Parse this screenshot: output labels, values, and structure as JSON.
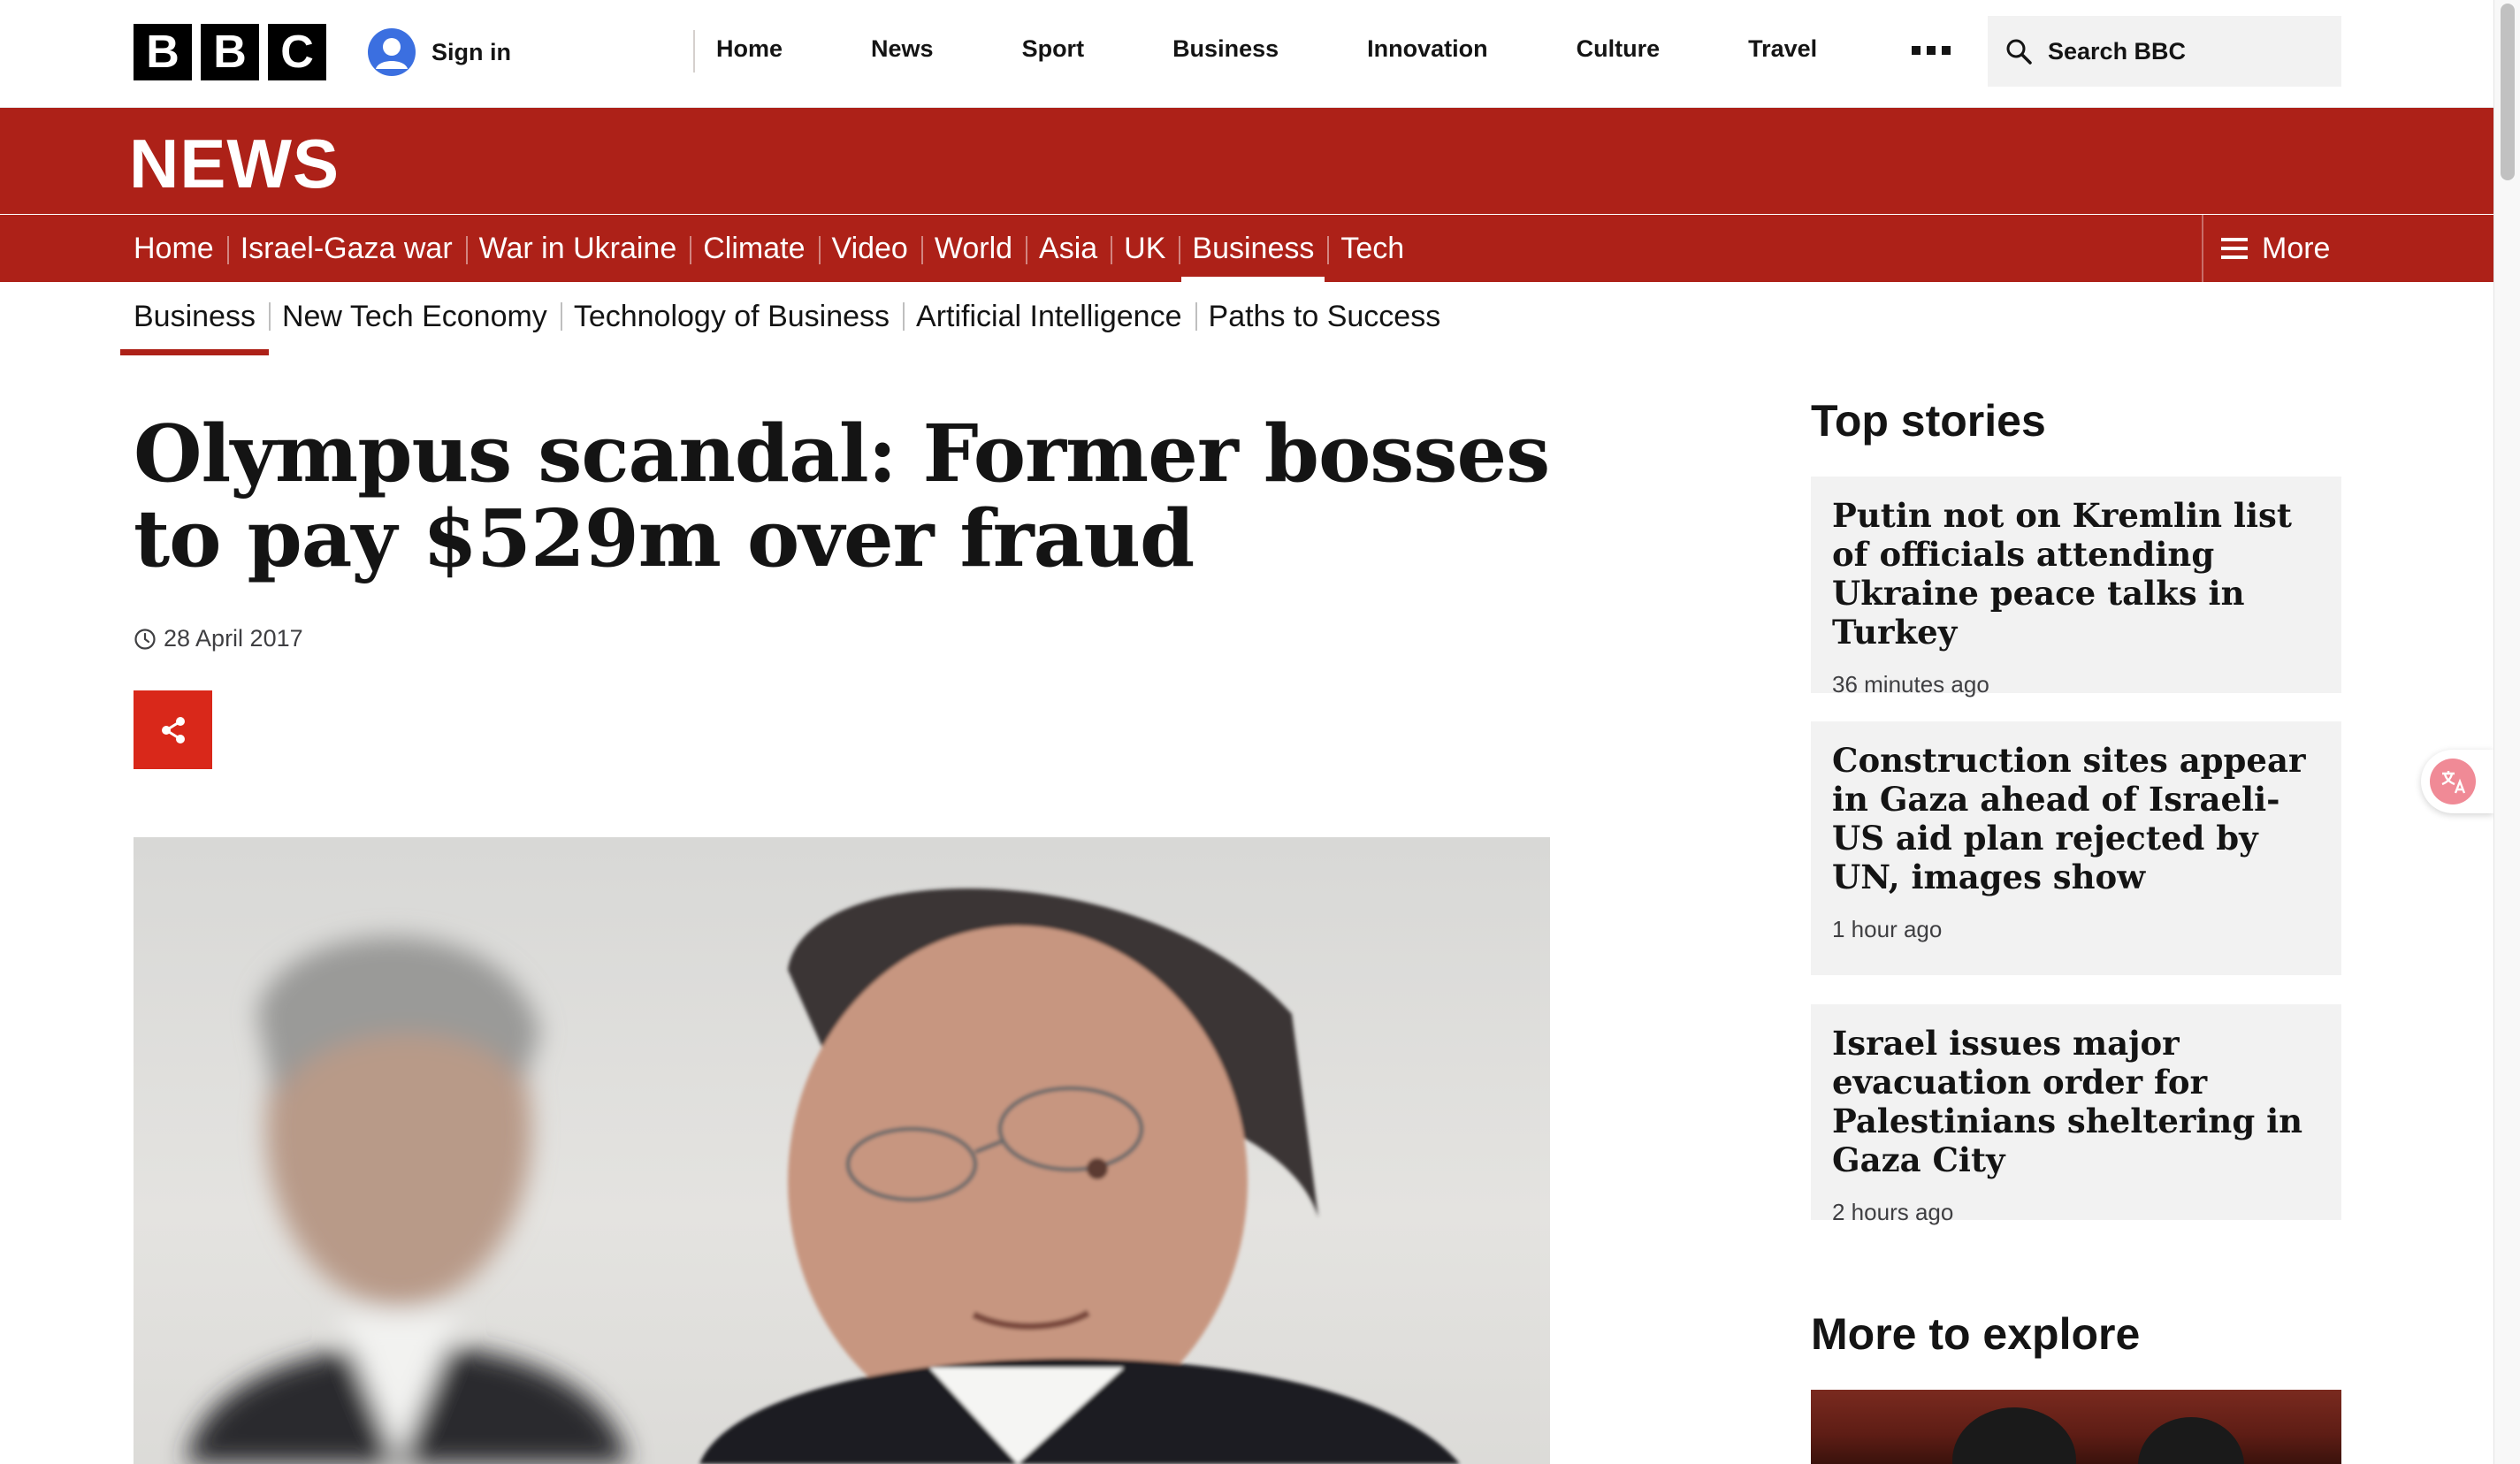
{
  "masthead": {
    "logo_letters": [
      "B",
      "B",
      "C"
    ],
    "sign_in_label": "Sign in",
    "nav": [
      "Home",
      "News",
      "Sport",
      "Business",
      "Innovation",
      "Culture",
      "Travel"
    ],
    "more_icon": "more-dots-icon",
    "search_placeholder": "Search BBC"
  },
  "banner": {
    "title": "NEWS",
    "color": "#ad2118"
  },
  "section_nav": {
    "items": [
      "Home",
      "Israel-Gaza war",
      "War in Ukraine",
      "Climate",
      "Video",
      "World",
      "Asia",
      "UK",
      "Business",
      "Tech"
    ],
    "active": "Business",
    "more_label": "More"
  },
  "sub_nav": {
    "items": [
      "Business",
      "New Tech Economy",
      "Technology of Business",
      "Artificial Intelligence",
      "Paths to Success"
    ],
    "active": "Business"
  },
  "article": {
    "headline": "Olympus scandal: Former bosses to pay $529m over fraud",
    "date": "28 April 2017",
    "share_icon": "share-icon",
    "share_color": "#d9281a"
  },
  "sidebar": {
    "top_stories_title": "Top stories",
    "stories": [
      {
        "headline": "Putin not on Kremlin list of officials attending Ukraine peace talks in Turkey",
        "time": "36 minutes ago"
      },
      {
        "headline": "Construction sites appear in Gaza ahead of Israeli-US aid plan rejected by UN, images show",
        "time": "1 hour ago"
      },
      {
        "headline": "Israel issues major evacuation order for Palestinians sheltering in Gaza City",
        "time": "2 hours ago"
      }
    ],
    "more_to_explore_title": "More to explore"
  }
}
